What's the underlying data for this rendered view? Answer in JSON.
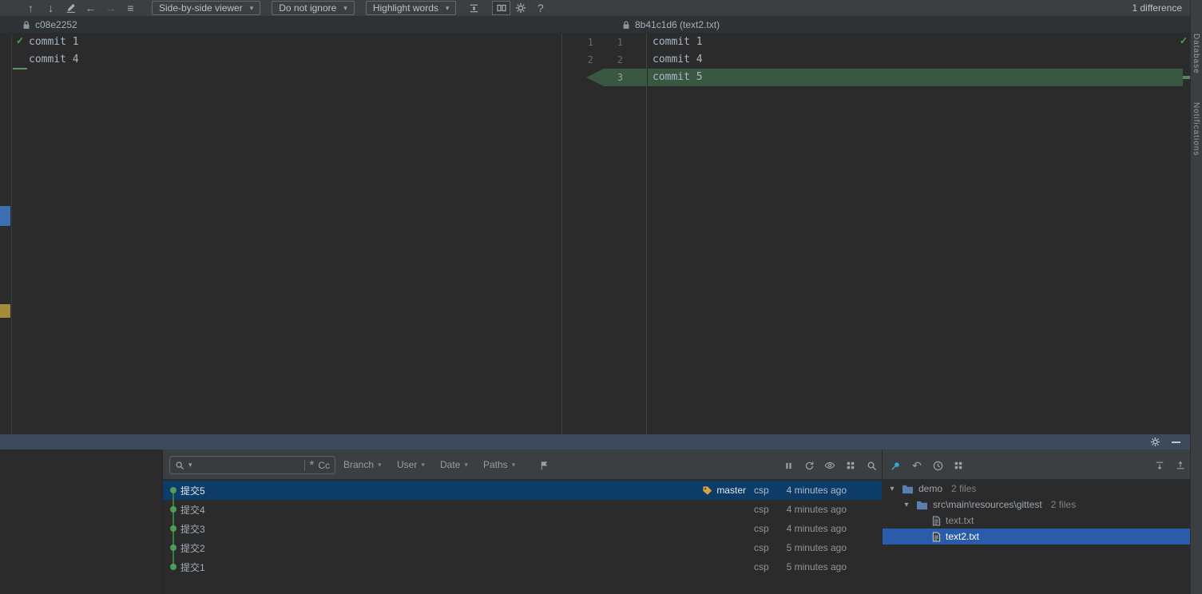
{
  "top_toolbar": {
    "viewer_dropdown": "Side-by-side viewer",
    "ignore_dropdown": "Do not ignore",
    "highlight_dropdown": "Highlight words",
    "help_label": "?",
    "difference_count": "1 difference"
  },
  "diff": {
    "left_title": "c08e2252",
    "right_title": "8b41c1d6 (text2.txt)",
    "left_lines": [
      {
        "num": "1",
        "text": "commit 1"
      },
      {
        "num": "2",
        "text": "commit 4"
      }
    ],
    "right_lines": [
      {
        "num": "1",
        "text": "commit 1"
      },
      {
        "num": "2",
        "text": "commit 4"
      },
      {
        "num": "3",
        "text": "commit 5"
      }
    ]
  },
  "log_toolbar": {
    "search_value": "",
    "regex_label": "*",
    "match_case_label": "Cc",
    "branch_filter": "Branch",
    "user_filter": "User",
    "date_filter": "Date",
    "paths_filter": "Paths"
  },
  "commits": [
    {
      "subject": "提交5",
      "ref": "master",
      "author": "csp",
      "time": "4 minutes ago"
    },
    {
      "subject": "提交4",
      "author": "csp",
      "time": "4 minutes ago"
    },
    {
      "subject": "提交3",
      "author": "csp",
      "time": "4 minutes ago"
    },
    {
      "subject": "提交2",
      "author": "csp",
      "time": "5 minutes ago"
    },
    {
      "subject": "提交1",
      "author": "csp",
      "time": "5 minutes ago"
    }
  ],
  "file_tree": {
    "root_name": "demo",
    "root_count": "2 files",
    "dir_name": "src\\main\\resources\\gittest",
    "dir_count": "2 files",
    "file1_name": "text.txt",
    "file2_name": "text2.txt"
  },
  "right_stripe": {
    "label_database": "Database",
    "label_notifications": "Notifications"
  },
  "icons": {
    "prev_difference": "↑",
    "next_difference": "↓",
    "go_back": "←",
    "go_forward": "→",
    "menu": "≡",
    "caret_down": "▾",
    "check": "✓",
    "undo": "↶"
  }
}
